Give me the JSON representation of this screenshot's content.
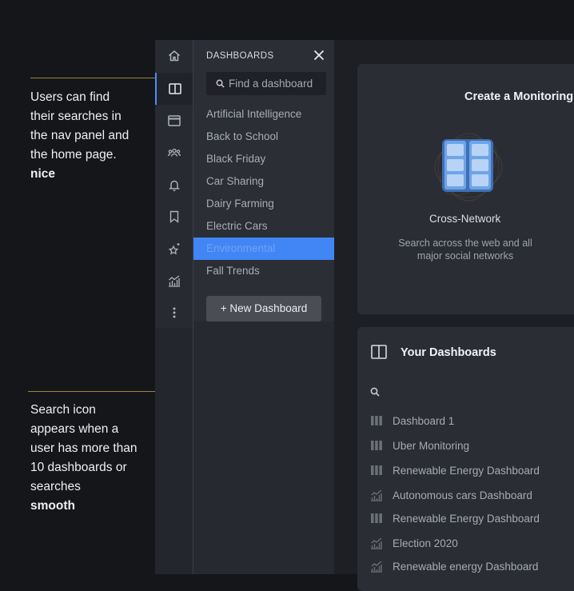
{
  "annotations": {
    "note1": {
      "lines": [
        "Users can find",
        "their searches in",
        "the nav panel and",
        "the home page."
      ],
      "bold": "nice"
    },
    "note2": {
      "lines": [
        "Search icon",
        "appears when a",
        "user has more than",
        "10 dashboards or",
        "searches"
      ],
      "bold": "smooth"
    }
  },
  "rail": {
    "items": [
      {
        "icon": "home-icon"
      },
      {
        "icon": "dashboards-icon",
        "active": true
      },
      {
        "icon": "browser-window-icon"
      },
      {
        "icon": "users-group-icon"
      },
      {
        "icon": "bell-icon"
      },
      {
        "icon": "bookmark-icon"
      },
      {
        "icon": "sparkle-star-icon"
      },
      {
        "icon": "analytics-chart-icon"
      },
      {
        "icon": "more-vertical-icon"
      }
    ]
  },
  "panel": {
    "title": "DASHBOARDS",
    "search_placeholder": "Find a dashboard",
    "items": [
      {
        "label": "Artificial Intelligence"
      },
      {
        "label": "Back to School"
      },
      {
        "label": "Black Friday"
      },
      {
        "label": "Car Sharing"
      },
      {
        "label": "Dairy Farming"
      },
      {
        "label": "Electric Cars"
      },
      {
        "label": "Environmental",
        "selected": true
      },
      {
        "label": "Fall Trends"
      }
    ],
    "new_button": "+ New Dashboard"
  },
  "create_card": {
    "title": "Create a Monitoring",
    "option": {
      "name": "Cross-Network",
      "description": "Search across the web and all major social networks",
      "icon": "cross-network-icon"
    }
  },
  "your_dashboards": {
    "title": "Your Dashboards",
    "items": [
      {
        "label": "Dashboard 1",
        "icon": "columns-icon"
      },
      {
        "label": "Uber Monitoring",
        "icon": "columns-icon"
      },
      {
        "label": "Renewable Energy Dashboard",
        "icon": "columns-icon"
      },
      {
        "label": "Autonomous cars Dashboard",
        "icon": "analytics-icon"
      },
      {
        "label": "Renewable Energy Dashboard",
        "icon": "columns-icon"
      },
      {
        "label": "Election 2020",
        "icon": "analytics-icon"
      },
      {
        "label": "Renewable energy Dashboard",
        "icon": "analytics-icon"
      }
    ]
  },
  "colors": {
    "accent": "#4285f4",
    "annotation_line": "#9b8442",
    "background": "#151619"
  }
}
